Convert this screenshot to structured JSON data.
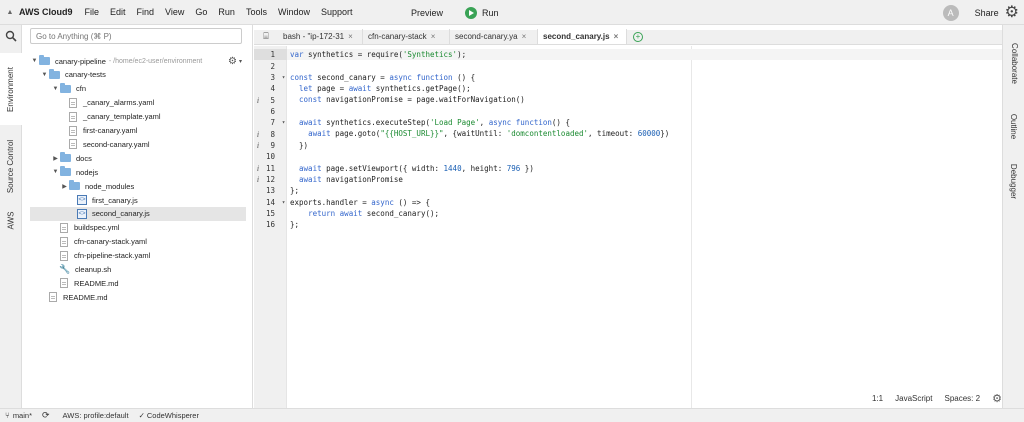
{
  "menubar": {
    "brand": "AWS Cloud9",
    "items": [
      "File",
      "Edit",
      "Find",
      "View",
      "Go",
      "Run",
      "Tools",
      "Window",
      "Support"
    ],
    "preview": "Preview",
    "run": "Run",
    "avatar_letter": "A",
    "share": "Share"
  },
  "left_tabs": [
    "Environment",
    "Source Control",
    "AWS"
  ],
  "right_tabs": [
    "Collaborate",
    "Outline",
    "Debugger"
  ],
  "tree": {
    "search_placeholder": "Go to Anything (⌘ P)",
    "rows": [
      {
        "name": "canary-pipeline",
        "path": "- /home/ec2-user/environment",
        "type": "folder",
        "expanded": true,
        "depth": 0
      },
      {
        "name": "canary-tests",
        "type": "folder",
        "expanded": true,
        "depth": 1
      },
      {
        "name": "cfn",
        "type": "folder",
        "expanded": true,
        "depth": 2
      },
      {
        "name": "_canary_alarms.yaml",
        "type": "file",
        "depth": 3
      },
      {
        "name": "_canary_template.yaml",
        "type": "file",
        "depth": 3
      },
      {
        "name": "first-canary.yaml",
        "type": "file",
        "depth": 3
      },
      {
        "name": "second-canary.yaml",
        "type": "file",
        "depth": 3
      },
      {
        "name": "docs",
        "type": "folder",
        "expanded": false,
        "depth": 2
      },
      {
        "name": "nodejs",
        "type": "folder",
        "expanded": true,
        "depth": 2
      },
      {
        "name": "node_modules",
        "type": "folder",
        "expanded": false,
        "depth": 3
      },
      {
        "name": "first_canary.js",
        "type": "js",
        "depth": 4
      },
      {
        "name": "second_canary.js",
        "type": "js",
        "depth": 4,
        "selected": true
      },
      {
        "name": "buildspec.yml",
        "type": "file",
        "depth": 2
      },
      {
        "name": "cfn-canary-stack.yaml",
        "type": "file",
        "depth": 2
      },
      {
        "name": "cfn-pipeline-stack.yaml",
        "type": "file",
        "depth": 2
      },
      {
        "name": "cleanup.sh",
        "type": "sh",
        "depth": 2
      },
      {
        "name": "README.md",
        "type": "file",
        "depth": 2
      },
      {
        "name": "README.md",
        "type": "file",
        "depth": 1
      }
    ]
  },
  "tabs": [
    {
      "label": "bash - \"ip-172-31",
      "closable": true,
      "active": false
    },
    {
      "label": "cfn-canary-stack",
      "closable": true,
      "active": false
    },
    {
      "label": "second-canary.ya",
      "closable": true,
      "active": false
    },
    {
      "label": "second_canary.js",
      "closable": true,
      "active": true
    }
  ],
  "editor": {
    "lines": [
      {
        "n": "1",
        "info": "",
        "fold": "",
        "active": true,
        "html": "<span class=\"kw\">var</span> synthetics = require(<span class=\"str\">'Synthetics'</span>);"
      },
      {
        "n": "2",
        "info": "",
        "fold": "",
        "html": ""
      },
      {
        "n": "3",
        "info": "",
        "fold": "▾",
        "html": "<span class=\"kw\">const</span> second_canary = <span class=\"kw\">async</span> <span class=\"kw\">function</span> () {"
      },
      {
        "n": "4",
        "info": "",
        "fold": "",
        "html": "  <span class=\"kw\">let</span> page = <span class=\"kw\">await</span> synthetics.getPage();"
      },
      {
        "n": "5",
        "info": "i",
        "fold": "",
        "html": "  <span class=\"kw\">const</span> navigationPromise = page.waitForNavigation()"
      },
      {
        "n": "6",
        "info": "",
        "fold": "",
        "html": ""
      },
      {
        "n": "7",
        "info": "",
        "fold": "▾",
        "html": "  <span class=\"kw\">await</span> synthetics.executeStep(<span class=\"str\">'Load Page'</span>, <span class=\"kw\">async</span> <span class=\"kw\">function</span>() {"
      },
      {
        "n": "8",
        "info": "i",
        "fold": "",
        "html": "    <span class=\"kw\">await</span> page.goto(<span class=\"str\">\"{{HOST_URL}}\"</span>, {waitUntil: <span class=\"str\">'domcontentloaded'</span>, timeout: <span class=\"num-lit\">60000</span>})"
      },
      {
        "n": "9",
        "info": "i",
        "fold": "",
        "html": "  })"
      },
      {
        "n": "10",
        "info": "",
        "fold": "",
        "html": ""
      },
      {
        "n": "11",
        "info": "i",
        "fold": "",
        "html": "  <span class=\"kw\">await</span> page.setViewport({ width: <span class=\"num-lit\">1440</span>, height: <span class=\"num-lit\">796</span> })"
      },
      {
        "n": "12",
        "info": "i",
        "fold": "",
        "html": "  <span class=\"kw\">await</span> navigationPromise"
      },
      {
        "n": "13",
        "info": "",
        "fold": "",
        "html": "};"
      },
      {
        "n": "14",
        "info": "",
        "fold": "▾",
        "html": "exports.handler = <span class=\"kw\">async</span> () => {"
      },
      {
        "n": "15",
        "info": "",
        "fold": "",
        "html": "    <span class=\"kw\">return</span> <span class=\"kw\">await</span> second_canary();"
      },
      {
        "n": "16",
        "info": "",
        "fold": "",
        "html": "};"
      }
    ],
    "status": {
      "cursor": "1:1",
      "language": "JavaScript",
      "spaces": "Spaces: 2"
    }
  },
  "statusbar": {
    "branch": "main*",
    "profile": "AWS: profile:default",
    "codewhisperer": "CodeWhisperer"
  }
}
